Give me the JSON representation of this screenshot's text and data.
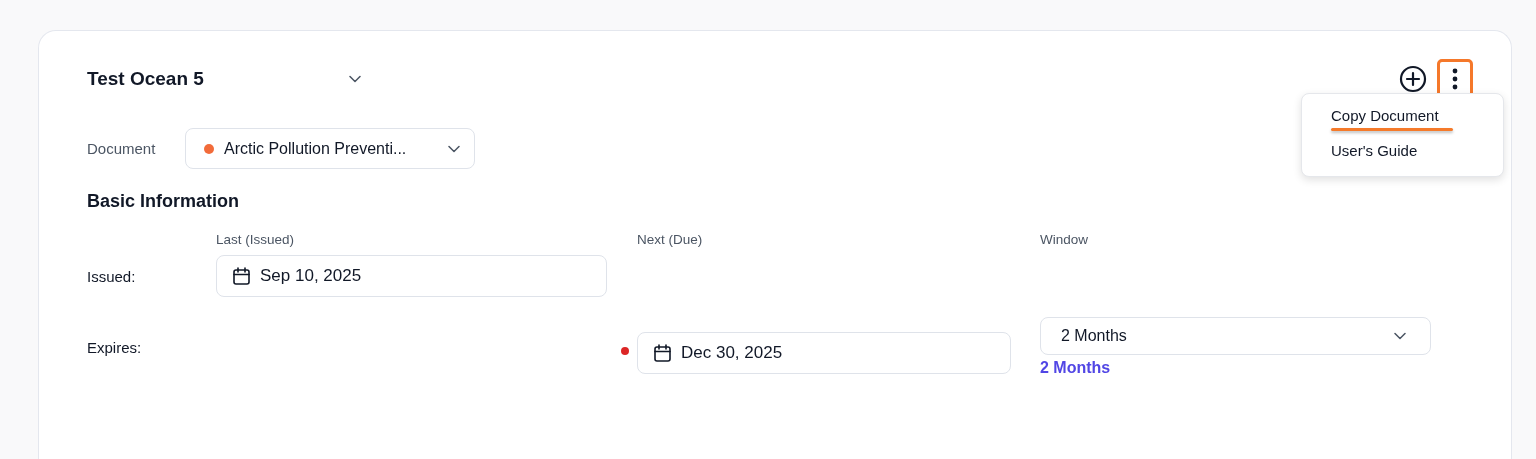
{
  "header": {
    "title": "Test Ocean 5",
    "kebab_highlighted": true
  },
  "document": {
    "label": "Document",
    "value": "Arctic Pollution Preventi...",
    "color": "#f26b3a"
  },
  "menu": {
    "items": [
      {
        "label": "Copy Document",
        "underlined": true
      },
      {
        "label": "User's Guide",
        "underlined": false
      }
    ]
  },
  "section": {
    "title": "Basic Information",
    "columns": [
      "Last (Issued)",
      "Next (Due)",
      "Window"
    ],
    "rows": [
      {
        "label": "Issued:",
        "cells": [
          {
            "kind": "date",
            "value": "Sep 10, 2025",
            "required": false
          },
          {
            "kind": "empty"
          },
          {
            "kind": "empty"
          }
        ]
      },
      {
        "label": "Expires:",
        "cells": [
          {
            "kind": "empty"
          },
          {
            "kind": "date",
            "value": "Dec 30, 2025",
            "required": true
          },
          {
            "kind": "select",
            "value": "2 Months",
            "note": "2 Months"
          }
        ]
      }
    ]
  }
}
